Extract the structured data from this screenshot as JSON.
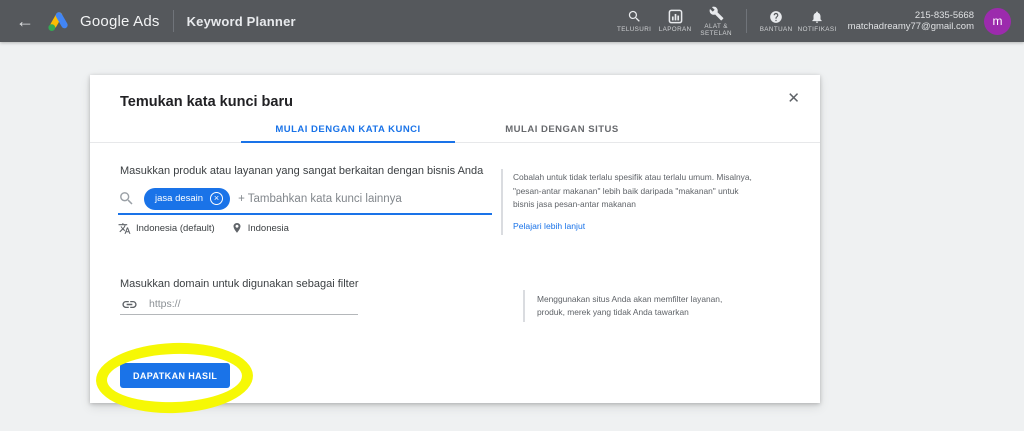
{
  "header": {
    "back_icon": "←",
    "app_name": "Google Ads",
    "page_title": "Keyword Planner",
    "nav": [
      {
        "label": "TELUSURI"
      },
      {
        "label": "LAPORAN"
      },
      {
        "label": "ALAT & SETELAN"
      },
      {
        "label": "BANTUAN"
      },
      {
        "label": "NOTIFIKASI"
      }
    ],
    "account": {
      "phone": "215-835-5668",
      "email": "matchadreamy77@gmail.com",
      "avatar_initial": "m"
    }
  },
  "modal": {
    "title": "Temukan kata kunci baru",
    "close_icon": "✕",
    "tabs": [
      {
        "label": "MULAI DENGAN KATA KUNCI",
        "active": true
      },
      {
        "label": "MULAI DENGAN SITUS",
        "active": false
      }
    ],
    "keywords_section": {
      "label": "Masukkan produk atau layanan yang sangat berkaitan dengan bisnis Anda",
      "chip": {
        "text": "jasa desain",
        "remove_icon": "×"
      },
      "input_placeholder": "+ Tambahkan kata kunci lainnya",
      "language": "Indonesia (default)",
      "location": "Indonesia",
      "hint": "Cobalah untuk tidak terlalu spesifik atau terlalu umum. Misalnya, \"pesan-antar makanan\" lebih baik daripada \"makanan\" untuk bisnis jasa pesan-antar makanan",
      "hint_link": "Pelajari lebih lanjut"
    },
    "domain_section": {
      "label": "Masukkan domain untuk digunakan sebagai filter",
      "input_placeholder": "https://",
      "hint": "Menggunakan situs Anda akan memfilter layanan, produk, merek yang tidak Anda tawarkan"
    },
    "submit_label": "DAPATKAN HASIL"
  },
  "colors": {
    "accent_blue": "#1a73e8",
    "header_bg": "#55585c",
    "highlight_yellow": "#f6f805",
    "avatar_purple": "#9c2bad"
  }
}
